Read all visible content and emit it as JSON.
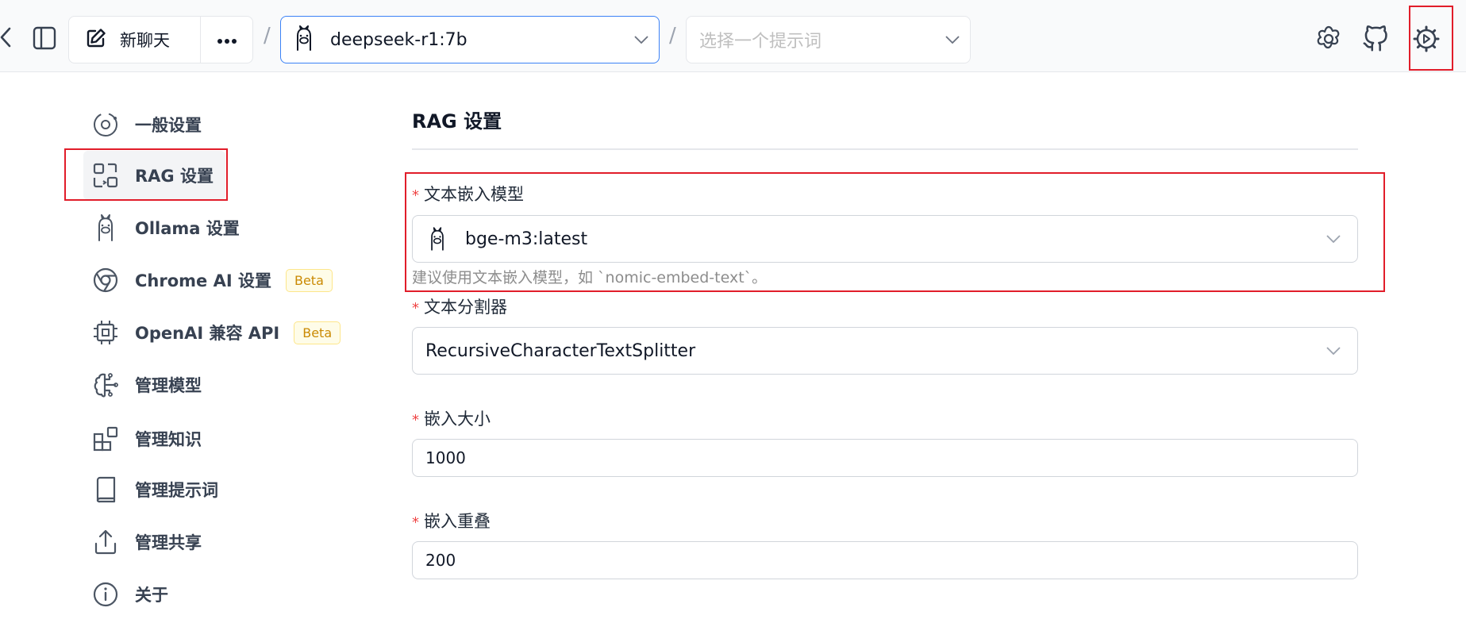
{
  "topbar": {
    "new_chat_label": "新聊天",
    "model_select_value": "deepseek-r1:7b",
    "prompt_select_placeholder": "选择一个提示词",
    "separator": "/"
  },
  "sidebar": {
    "items": [
      {
        "label": "一般设置",
        "icon": "general-settings-icon"
      },
      {
        "label": "RAG 设置",
        "icon": "rag-icon",
        "active": true
      },
      {
        "label": "Ollama 设置",
        "icon": "ollama-llama-icon"
      },
      {
        "label": "Chrome AI 设置",
        "icon": "chrome-icon",
        "badge": "Beta"
      },
      {
        "label": "OpenAI 兼容 API",
        "icon": "cpu-chip-icon",
        "badge": "Beta"
      },
      {
        "label": "管理模型",
        "icon": "brain-icon"
      },
      {
        "label": "管理知识",
        "icon": "blocks-icon"
      },
      {
        "label": "管理提示词",
        "icon": "book-icon"
      },
      {
        "label": "管理共享",
        "icon": "share-icon"
      },
      {
        "label": "关于",
        "icon": "info-icon"
      }
    ]
  },
  "main": {
    "title": "RAG 设置",
    "fields": {
      "embedding_model": {
        "label": "文本嵌入模型",
        "value": "bge-m3:latest",
        "help": "建议使用文本嵌入模型，如 `nomic-embed-text`。"
      },
      "splitter": {
        "label": "文本分割器",
        "value": "RecursiveCharacterTextSplitter"
      },
      "chunk_size": {
        "label": "嵌入大小",
        "value": "1000"
      },
      "chunk_overlap": {
        "label": "嵌入重叠",
        "value": "200"
      }
    },
    "required_mark": "*"
  },
  "colors": {
    "accent_blue": "#3b82f6",
    "highlight_red": "#e11d2a",
    "beta_yellow": "#ca8a04",
    "required_red": "#ef4444"
  }
}
